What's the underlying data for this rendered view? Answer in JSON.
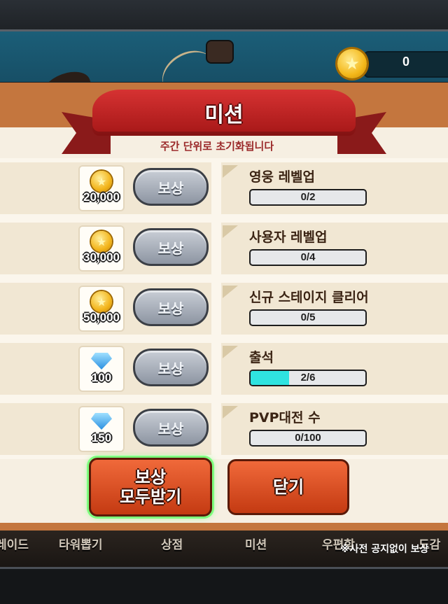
{
  "hud": {
    "coin_value": "0"
  },
  "panel": {
    "title": "미션",
    "subtitle": "주간 단위로 초기화됩니다",
    "missions": [
      {
        "reward_type": "coin",
        "reward_amount": "20,000",
        "button": "보상",
        "title": "영웅 레벨업",
        "progress_text": "0/2",
        "progress": 0.0
      },
      {
        "reward_type": "coin",
        "reward_amount": "30,000",
        "button": "보상",
        "title": "사용자 레벨업",
        "progress_text": "0/4",
        "progress": 0.0
      },
      {
        "reward_type": "coin",
        "reward_amount": "50,000",
        "button": "보상",
        "title": "신규 스테이지 클리어",
        "progress_text": "0/5",
        "progress": 0.0
      },
      {
        "reward_type": "gem",
        "reward_amount": "100",
        "button": "보상",
        "title": "출석",
        "progress_text": "2/6",
        "progress": 0.333
      },
      {
        "reward_type": "gem",
        "reward_amount": "150",
        "button": "보상",
        "title": "PVP대전 수",
        "progress_text": "0/100",
        "progress": 0.0
      }
    ],
    "claim_all_line1": "보상",
    "claim_all_line2": "모두받기",
    "close_label": "닫기"
  },
  "nav": {
    "items": [
      "레이드",
      "타워뽑기",
      "상점",
      "미션",
      "우편함",
      "도감"
    ],
    "notice": "※사전 공지없이 보상"
  },
  "colors": {
    "accent_red": "#c43a12",
    "progress_fill": "#2fe3e0",
    "highlight_green": "#7dff7d"
  }
}
